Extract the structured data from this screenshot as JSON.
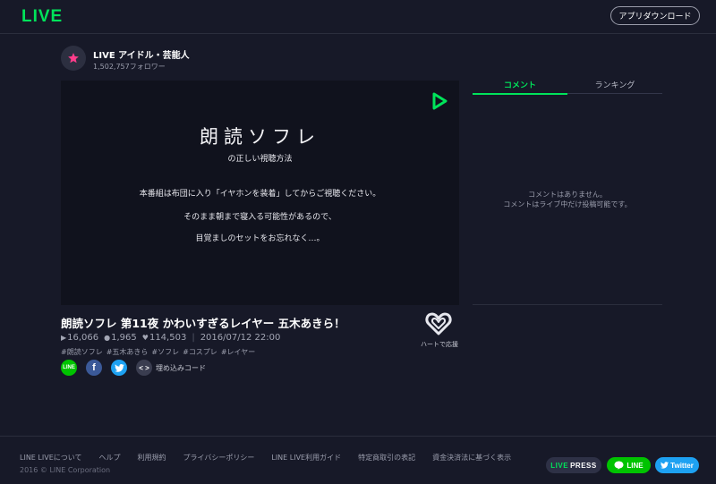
{
  "header": {
    "logo": "LIVE",
    "download_button": "アプリダウンロード"
  },
  "channel": {
    "name": "LIVE アイドル・芸能人",
    "followers": "1,502,757フォロワー",
    "icon": "star-icon",
    "icon_color": "#ff3d8b"
  },
  "player": {
    "title": "朗読ソフレ",
    "subtitle": "の正しい視聴方法",
    "lines": [
      "本番組は布団に入り「イヤホンを装着」してからご視聴ください。",
      "そのまま朝まで寝入る可能性があるので、",
      "目覚ましのセットをお忘れなく…。"
    ],
    "play_icon": "play-icon"
  },
  "tabs": [
    {
      "label": "コメント",
      "active": true
    },
    {
      "label": "ランキング",
      "active": false
    }
  ],
  "comments": {
    "empty_line1": "コメントはありません。",
    "empty_line2": "コメントはライブ中だけ投稿可能です。"
  },
  "video": {
    "title": "朗読ソフレ 第11夜 かわいすぎるレイヤー 五木あきら！",
    "views": "16,066",
    "comments": "1,965",
    "likes": "114,503",
    "date": "2016/07/12 22:00",
    "tags": [
      "#朗読ソフレ",
      "#五木あきら",
      "#ソフレ",
      "#コスプレ",
      "#レイヤー"
    ],
    "heart_label": "ハートで応援"
  },
  "share": {
    "line_label": "LINE",
    "facebook_label": "f",
    "embed_label": "埋め込みコード",
    "embed_glyph": "< >"
  },
  "footer": {
    "links": [
      "LINE LIVEについて",
      "ヘルプ",
      "利用規約",
      "プライバシーポリシー",
      "LINE LIVE利用ガイド",
      "特定商取引の表記",
      "資金決済法に基づく表示"
    ],
    "copyright": "2016 © LINE Corporation",
    "press": {
      "prefix": "LIVE",
      "suffix": "PRESS"
    },
    "line_button": "LINE",
    "twitter_button": "Twitter"
  },
  "colors": {
    "background": "#171928",
    "accent": "#00e35a",
    "line_green": "#00c300",
    "twitter_blue": "#1da1f2",
    "facebook_blue": "#3b5998"
  }
}
